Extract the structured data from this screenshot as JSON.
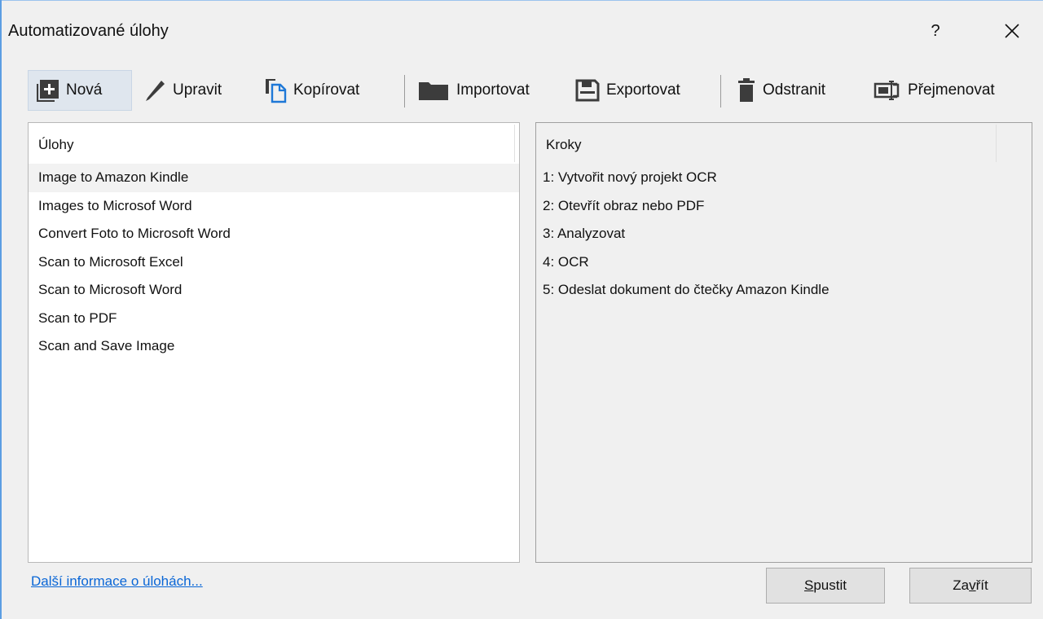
{
  "window": {
    "title": "Automatizované úlohy",
    "help_label": "?"
  },
  "toolbar": {
    "items": [
      {
        "label": "Nová",
        "icon": "add-box-icon"
      },
      {
        "label": "Upravit",
        "icon": "pencil-icon"
      },
      {
        "label": "Kopírovat",
        "icon": "copy-icon"
      },
      {
        "label": "Importovat",
        "icon": "folder-icon"
      },
      {
        "label": "Exportovat",
        "icon": "save-icon"
      },
      {
        "label": "Odstranit",
        "icon": "trash-icon"
      },
      {
        "label": "Přejmenovat",
        "icon": "rename-icon"
      }
    ]
  },
  "tasks": {
    "header": "Úlohy",
    "items": [
      "Image to Amazon Kindle",
      "Images to Microsof Word",
      "Convert Foto to Microsoft Word",
      "Scan to Microsoft Excel",
      "Scan to Microsoft Word",
      "Scan to PDF",
      "Scan and Save Image"
    ],
    "selected_index": 0
  },
  "steps": {
    "header": "Kroky",
    "items": [
      "1: Vytvořit nový projekt OCR",
      "2: Otevřít obraz nebo PDF",
      "3: Analyzovat",
      "4: OCR",
      "5: Odeslat dokument do čtečky Amazon Kindle"
    ]
  },
  "footer": {
    "more_info_link": "Další informace o úlohách...",
    "run_button": {
      "prefix": "",
      "accel": "S",
      "rest": "pustit"
    },
    "close_button": {
      "prefix": "Za",
      "accel": "v",
      "rest": "řít"
    }
  },
  "colors": {
    "link": "#0a66d6",
    "active_bg": "#dfe6ee",
    "icon_dark": "#3c3c3c",
    "icon_blue": "#1e78d7"
  }
}
